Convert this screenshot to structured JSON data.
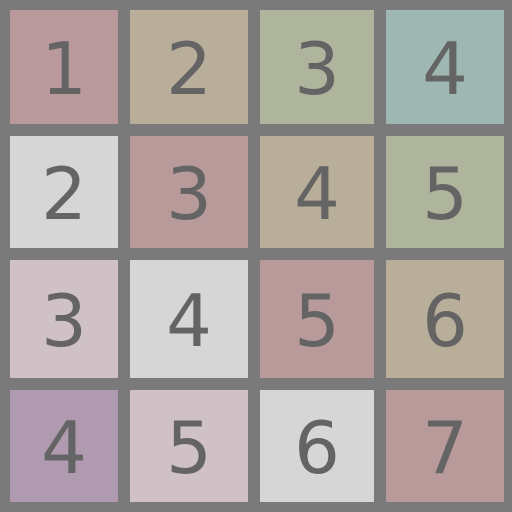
{
  "board": {
    "rows": [
      [
        {
          "label": "1",
          "color": "#b9999b"
        },
        {
          "label": "2",
          "color": "#b8ae9a"
        },
        {
          "label": "3",
          "color": "#afb59c"
        },
        {
          "label": "4",
          "color": "#9fb7b2"
        }
      ],
      [
        {
          "label": "2",
          "color": "#d6d6d6"
        },
        {
          "label": "3",
          "color": "#b99a9b"
        },
        {
          "label": "4",
          "color": "#b8ae9a"
        },
        {
          "label": "5",
          "color": "#aeb59c"
        }
      ],
      [
        {
          "label": "3",
          "color": "#cfc1c5"
        },
        {
          "label": "4",
          "color": "#d6d6d6"
        },
        {
          "label": "5",
          "color": "#b99a9b"
        },
        {
          "label": "6",
          "color": "#b8ae9a"
        }
      ],
      [
        {
          "label": "4",
          "color": "#b09ab0"
        },
        {
          "label": "5",
          "color": "#cfc1c5"
        },
        {
          "label": "6",
          "color": "#d6d6d6"
        },
        {
          "label": "7",
          "color": "#b99a9b"
        }
      ]
    ],
    "grid_color": "#7a7a7a",
    "text_color": "#646464"
  }
}
